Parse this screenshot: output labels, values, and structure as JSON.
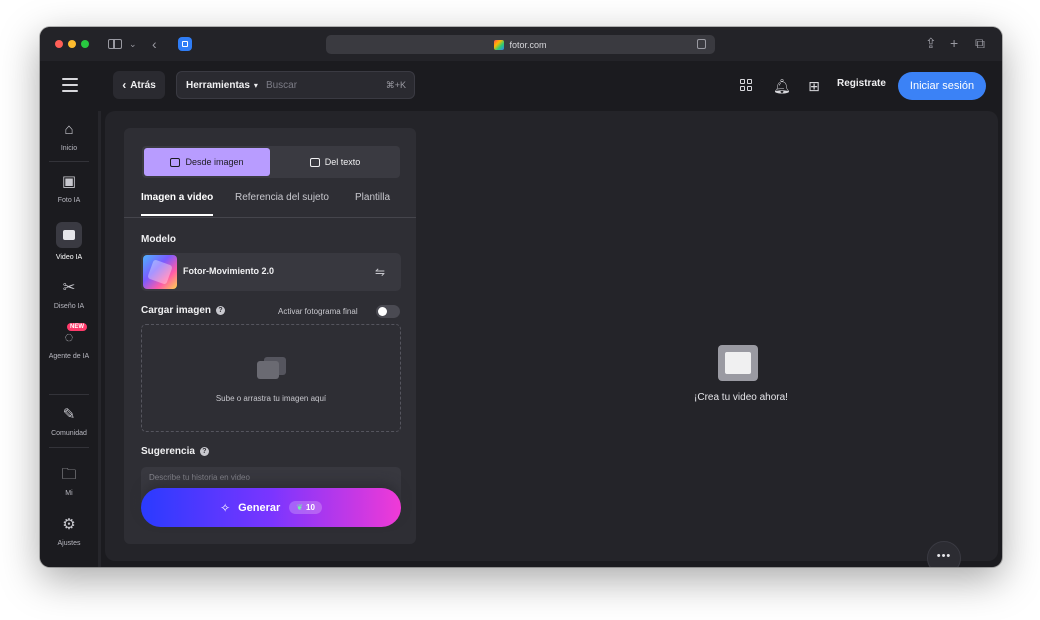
{
  "browser": {
    "url": "fotor.com"
  },
  "header": {
    "back_label": "Atrás",
    "tools_label": "Herramientas",
    "search_placeholder": "Buscar",
    "search_shortcut": "⌘+K",
    "register_label": "Registrate",
    "login_label": "Iniciar sesión"
  },
  "sidebar": {
    "items": [
      {
        "label": "Inicio",
        "icon": "home-icon"
      },
      {
        "label": "Foto IA",
        "icon": "photo-ai-icon"
      },
      {
        "label": "Video IA",
        "icon": "video-ai-icon"
      },
      {
        "label": "Diseño IA",
        "icon": "design-ai-icon"
      },
      {
        "label": "Agente de IA",
        "icon": "agent-icon",
        "badge": "NEW"
      },
      {
        "label": "Comunidad",
        "icon": "community-icon"
      },
      {
        "label": "Mi",
        "icon": "folder-icon"
      },
      {
        "label": "Ajustes",
        "icon": "gear-icon"
      }
    ]
  },
  "panel": {
    "mode_options": [
      "Desde imagen",
      "Del texto"
    ],
    "tabs": [
      "Imagen a video",
      "Referencia del sujeto",
      "Plantilla"
    ],
    "model_label": "Modelo",
    "model_name": "Fotor-Movimiento 2.0",
    "upload_label": "Cargar imagen",
    "final_frame_label": "Activar fotograma final",
    "upload_hint": "Sube o arrastra tu imagen aquí",
    "prompt_label": "Sugerencia",
    "prompt_placeholder": "Describe tu historia en video",
    "generate_label": "Generar",
    "credits": "10"
  },
  "preview": {
    "message": "¡Crea tu video ahora!"
  },
  "colors": {
    "accent_blue": "#3b82f6",
    "mode_active": "#b89cff",
    "generate_gradient": [
      "#2a3bff",
      "#7a35ff",
      "#f03ad6"
    ]
  }
}
